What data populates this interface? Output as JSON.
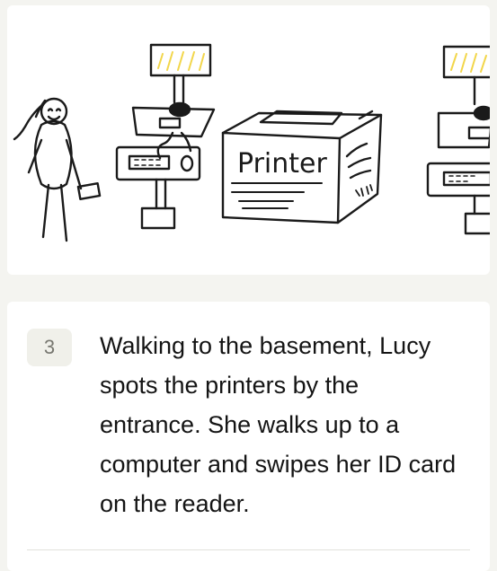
{
  "illustration": {
    "printer_label": "Printer",
    "colors": {
      "ink": "#1a1a1a",
      "lamp_yellow": "#f2d64b",
      "background": "#ffffff"
    }
  },
  "step": {
    "number": "3",
    "text": "Walking to the basement, Lucy spots the printers by the entrance. She walks up to a computer and swipes her ID card on the reader."
  }
}
